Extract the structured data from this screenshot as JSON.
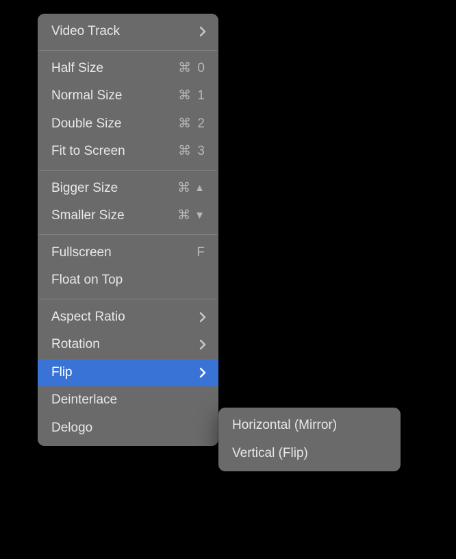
{
  "menu": {
    "videoTrack": "Video Track",
    "halfSize": {
      "label": "Half Size",
      "shortcut": "⌘ 0"
    },
    "normalSize": {
      "label": "Normal Size",
      "shortcut": "⌘ 1"
    },
    "doubleSize": {
      "label": "Double Size",
      "shortcut": "⌘ 2"
    },
    "fitToScreen": {
      "label": "Fit to Screen",
      "shortcut": "⌘ 3"
    },
    "biggerSize": {
      "label": "Bigger Size",
      "shortcutCmd": "⌘",
      "shortcutArrow": "▲"
    },
    "smallerSize": {
      "label": "Smaller Size",
      "shortcutCmd": "⌘",
      "shortcutArrow": "▼"
    },
    "fullscreen": {
      "label": "Fullscreen",
      "shortcut": "F"
    },
    "floatOnTop": "Float on Top",
    "aspectRatio": "Aspect Ratio",
    "rotation": "Rotation",
    "flip": "Flip",
    "deinterlace": "Deinterlace",
    "delogo": "Delogo"
  },
  "submenu": {
    "horizontal": "Horizontal (Mirror)",
    "vertical": "Vertical (Flip)"
  }
}
